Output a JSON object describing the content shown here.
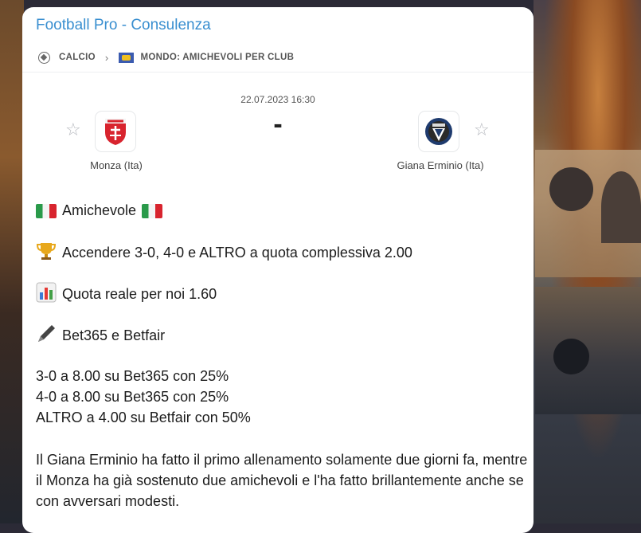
{
  "channel": {
    "title": "Football Pro - Consulenza"
  },
  "breadcrumb": {
    "sport_icon": "soccer-ball-icon",
    "sport": "CALCIO",
    "separator_icon": "chevron-right-icon",
    "competition_icon": "world-flag-icon",
    "competition": "MONDO: AMICHEVOLI PER CLUB"
  },
  "match": {
    "datetime": "22.07.2023 16:30",
    "score": "-",
    "home": {
      "name": "Monza (Ita)",
      "logo": "monza-crest-icon"
    },
    "away": {
      "name": "Giana Erminio (Ita)",
      "logo": "giana-erminio-crest-icon"
    }
  },
  "message": {
    "line_type": "Amichevole",
    "line_tip": "Accendere 3-0, 4-0 e ALTRO a quota complessiva 2.00",
    "line_quota": "Quota reale per noi 1.60",
    "line_books": "Bet365 e Betfair",
    "bets": [
      "3-0 a 8.00 su Bet365 con 25%",
      "4-0 a 8.00 su Bet365 con 25%",
      "ALTRO a 4.00 su Betfair con 50%"
    ],
    "analysis": "Il Giana Erminio ha fatto il primo allenamento solamente due giorni fa, mentre il Monza ha già sostenuto due amichevoli e l'ha fatto brillantemente anche se con avversari modesti."
  },
  "colors": {
    "accent": "#3a8fd0",
    "text": "#1c1c1c",
    "monza_red": "#d8242e",
    "giana_blue": "#1f3b6e"
  }
}
